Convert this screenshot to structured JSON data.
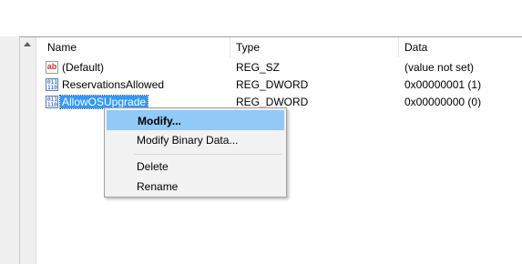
{
  "columns": {
    "name": "Name",
    "type": "Type",
    "data": "Data"
  },
  "rows": [
    {
      "icon": "string-value-icon",
      "icon_text": "ab",
      "name": "(Default)",
      "type": "REG_SZ",
      "data": "(value not set)",
      "selected": false
    },
    {
      "icon": "binary-value-icon",
      "icon_text": "011\n110",
      "name": "ReservationsAllowed",
      "type": "REG_DWORD",
      "data": "0x00000001 (1)",
      "selected": false
    },
    {
      "icon": "binary-value-icon",
      "icon_text": "011\n110",
      "name": "AllowOSUpgrade",
      "type": "REG_DWORD",
      "data": "0x00000000 (0)",
      "selected": true
    }
  ],
  "context_menu": {
    "modify": "Modify...",
    "modify_binary": "Modify Binary Data...",
    "delete": "Delete",
    "rename": "Rename"
  },
  "colors": {
    "selection": "#3399ff",
    "menu_hover": "#91c9f7",
    "menu_bg": "#f2f2f2"
  }
}
